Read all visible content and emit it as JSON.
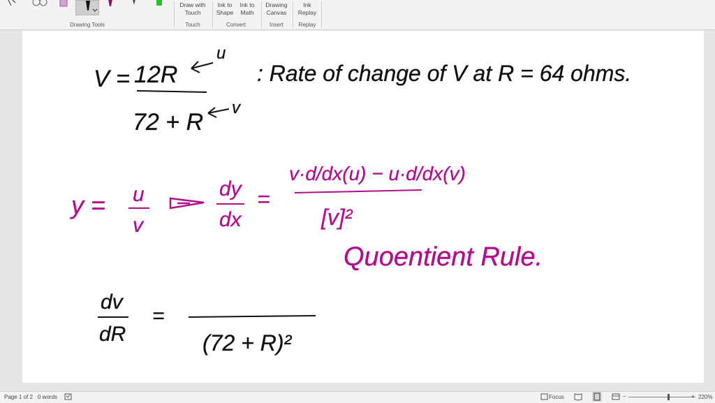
{
  "ribbon": {
    "groups": {
      "drawing_tools": "Drawing Tools",
      "touch": "Touch",
      "convert": "Convert",
      "insert": "Insert",
      "replay": "Replay"
    },
    "buttons": {
      "draw_with_touch": [
        "Draw with",
        "Touch"
      ],
      "ink_to_shape": [
        "Ink to",
        "Shape"
      ],
      "ink_to_math": [
        "Ink to",
        "Math"
      ],
      "drawing_canvas": [
        "Drawing",
        "Canvas"
      ],
      "ink_replay": [
        "Ink",
        "Replay"
      ]
    }
  },
  "status": {
    "page": "Page 1 of 2",
    "words": "0 words",
    "focus": "Focus",
    "zoom": "220%"
  },
  "ink": {
    "line1_left": "V =",
    "line1_num": "12R",
    "line1_u": "u",
    "line1_den": "72 + R",
    "line1_v": "v",
    "line1_text": ": Rate of change of V at R = 64 ohms.",
    "line2_y": "y =",
    "line2_frac_num": "u",
    "line2_frac_den": "v",
    "line2_dydx_num": "dy",
    "line2_dydx_den": "dx",
    "line2_eq": "=",
    "line2_rhs_num": "v·d/dx(u) − u·d/dx(v)",
    "line2_rhs_den": "[v]²",
    "quotient": "Quoentient Rule.",
    "line3_num": "dv",
    "line3_den": "dR",
    "line3_eq": "=",
    "line3_den2": "(72 + R)²"
  },
  "colors": {
    "ink_black": "#111111",
    "ink_magenta": "#b0108c"
  }
}
